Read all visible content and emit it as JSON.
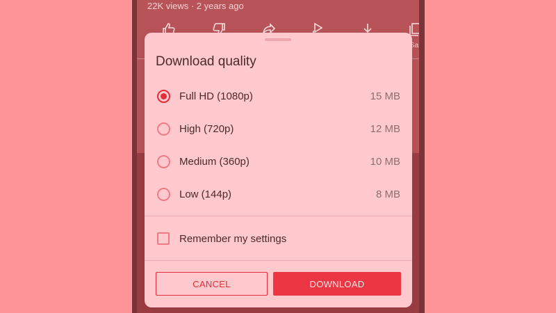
{
  "video": {
    "meta": "22K views · 2 years ago",
    "side_text": "Sa"
  },
  "actions": [
    {
      "icon": "thumbs-up-icon"
    },
    {
      "icon": "thumbs-down-icon"
    },
    {
      "icon": "share-icon"
    },
    {
      "icon": "remix-icon"
    },
    {
      "icon": "download-icon"
    },
    {
      "icon": "save-icon"
    }
  ],
  "dialog": {
    "title": "Download quality",
    "options": [
      {
        "label": "Full HD (1080p)",
        "size": "15 MB",
        "selected": true
      },
      {
        "label": "High (720p)",
        "size": "12 MB",
        "selected": false
      },
      {
        "label": "Medium (360p)",
        "size": "10 MB",
        "selected": false
      },
      {
        "label": "Low (144p)",
        "size": "8 MB",
        "selected": false
      }
    ],
    "remember_label": "Remember my settings",
    "remember_checked": false,
    "cancel_label": "CANCEL",
    "download_label": "DOWNLOAD"
  },
  "colors": {
    "accent": "#e52d3a",
    "dialog_bg": "#ffc9cd",
    "page_bg": "#ff9497"
  }
}
